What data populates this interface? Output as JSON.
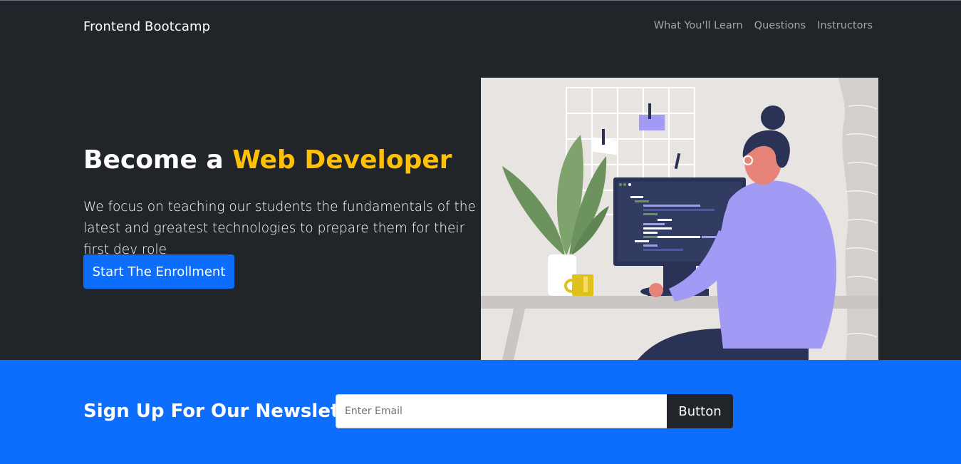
{
  "navbar": {
    "brand": "Frontend Bootcamp",
    "links": [
      "What You'll Learn",
      "Questions",
      "Instructors"
    ]
  },
  "hero": {
    "title_prefix": "Become a ",
    "title_accent": "Web Developer",
    "description": "We focus on teaching our students the fundamentals of the latest and greatest technologies to prepare them for their first dev role",
    "button_label": "Start The Enrollment",
    "illustration": "developer-at-desk-illustration"
  },
  "newsletter": {
    "title": "Sign Up For Our Newsleter",
    "email_placeholder": "Enter Email",
    "button_label": "Button"
  },
  "colors": {
    "dark_bg": "#212529",
    "accent": "#ffc107",
    "primary": "#0d6efd"
  }
}
